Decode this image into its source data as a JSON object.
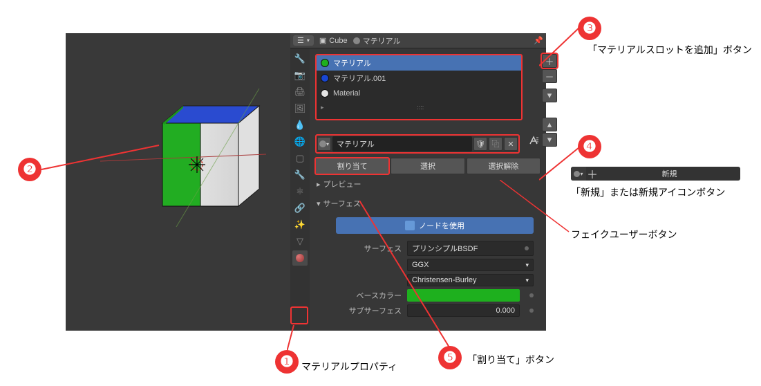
{
  "header": {
    "object_name": "Cube",
    "material_name": "マテリアル"
  },
  "material_slots": [
    {
      "name": "マテリアル",
      "color": "#1eb01e",
      "selected": true
    },
    {
      "name": "マテリアル.001",
      "color": "#1846d2",
      "selected": false
    },
    {
      "name": "Material",
      "color": "#e4e4e4",
      "selected": false
    }
  ],
  "material_selector": {
    "name": "マテリアル"
  },
  "assign_buttons": {
    "assign": "割り当て",
    "select": "選択",
    "deselect": "選択解除"
  },
  "sections": {
    "preview": "プレビュー",
    "surface": "サーフェス"
  },
  "surface_props": {
    "use_nodes_label": "ノードを使用",
    "surface_label": "サーフェス",
    "surface_type": "プリンシプルBSDF",
    "distribution": "GGX",
    "subsurface_method": "Christensen-Burley",
    "base_color_label": "ベースカラー",
    "base_color": "#1eb01e",
    "subsurface_label": "サブサーフェス",
    "subsurface_value": "0.000"
  },
  "new_button_panel": {
    "new_label": "新規"
  },
  "annotations": {
    "n1": "マテリアルプロパティ",
    "n3": "「マテリアルスロットを追加」ボタン",
    "n4_new": "「新規」または新規アイコンボタン",
    "n4_fake": "フェイクユーザーボタン",
    "n5": "「割り当て」ボタン"
  }
}
